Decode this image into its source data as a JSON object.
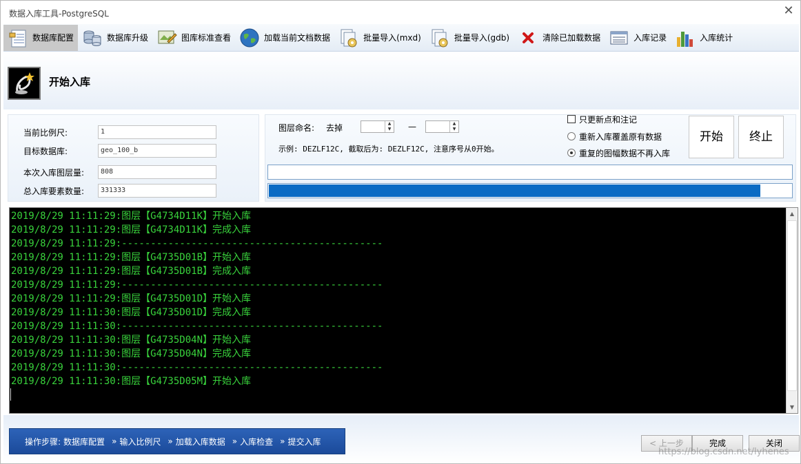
{
  "window": {
    "title": "数据入库工具-PostgreSQL",
    "close_icon": "close-icon"
  },
  "toolbar": {
    "items": [
      {
        "label": "数据库配置",
        "icon": "database-config-icon",
        "active": true
      },
      {
        "label": "数据库升级",
        "icon": "database-upgrade-icon",
        "active": false
      },
      {
        "label": "图库标准查看",
        "icon": "map-standard-icon",
        "active": false
      },
      {
        "label": "加载当前文档数据",
        "icon": "globe-icon",
        "active": false
      },
      {
        "label": "批量导入(mxd)",
        "icon": "batch-import-mxd-icon",
        "active": false
      },
      {
        "label": "批量导入(gdb)",
        "icon": "batch-import-gdb-icon",
        "active": false
      },
      {
        "label": "清除已加载数据",
        "icon": "clear-red-x-icon",
        "active": false
      },
      {
        "label": "入库记录",
        "icon": "record-list-icon",
        "active": false
      },
      {
        "label": "入库统计",
        "icon": "bar-chart-icon",
        "active": false
      }
    ]
  },
  "header": {
    "title": "开始入库",
    "logo": "wizard-logo-icon"
  },
  "params": {
    "scale_label": "当前比例尺:",
    "scale_value": "1",
    "target_db_label": "目标数据库:",
    "target_db_value": "geo_100_b",
    "layer_count_label": "本次入库图层量:",
    "layer_count_value": "808",
    "feature_count_label": "总入库要素数量:",
    "feature_count_value": "331333"
  },
  "naming": {
    "label": "图层命名:",
    "remove_label": "去掉",
    "dash": "—",
    "example": "示例: DEZLF12C, 截取后为: DEZLF12C, 注意序号从0开始。"
  },
  "options": {
    "only_update_label": "只更新点和注记",
    "only_update_checked": false,
    "overwrite_label": "重新入库覆盖原有数据",
    "overwrite_selected": false,
    "skip_label": "重复的图幅数据不再入库",
    "skip_selected": true
  },
  "buttons": {
    "start": "开始",
    "stop": "终止"
  },
  "progress": {
    "bar1_fraction": 0.0,
    "bar2_fraction": 0.94
  },
  "console": {
    "lines": [
      "2019/8/29 11:11:29:图层【G4734D11K】开始入库",
      "2019/8/29 11:11:29:图层【G4734D11K】完成入库",
      "2019/8/29 11:11:29:---------------------------------------------",
      "2019/8/29 11:11:29:图层【G4735D01B】开始入库",
      "2019/8/29 11:11:29:图层【G4735D01B】完成入库",
      "2019/8/29 11:11:29:---------------------------------------------",
      "2019/8/29 11:11:29:图层【G4735D01D】开始入库",
      "2019/8/29 11:11:30:图层【G4735D01D】完成入库",
      "2019/8/29 11:11:30:---------------------------------------------",
      "2019/8/29 11:11:30:图层【G4735D04N】开始入库",
      "2019/8/29 11:11:30:图层【G4735D04N】完成入库",
      "2019/8/29 11:11:30:---------------------------------------------",
      "2019/8/29 11:11:30:图层【G4735D05M】开始入库"
    ]
  },
  "footer": {
    "steps_prefix": "操作步骤:",
    "steps": [
      "数据库配置",
      "输入比例尺",
      "加载入库数据",
      "入库检查",
      "提交入库"
    ],
    "step_separator": "»",
    "prev": "< 上一步",
    "finish": "完成",
    "close": "关闭"
  },
  "watermark": "https://blog.csdn.net/lyhenes"
}
